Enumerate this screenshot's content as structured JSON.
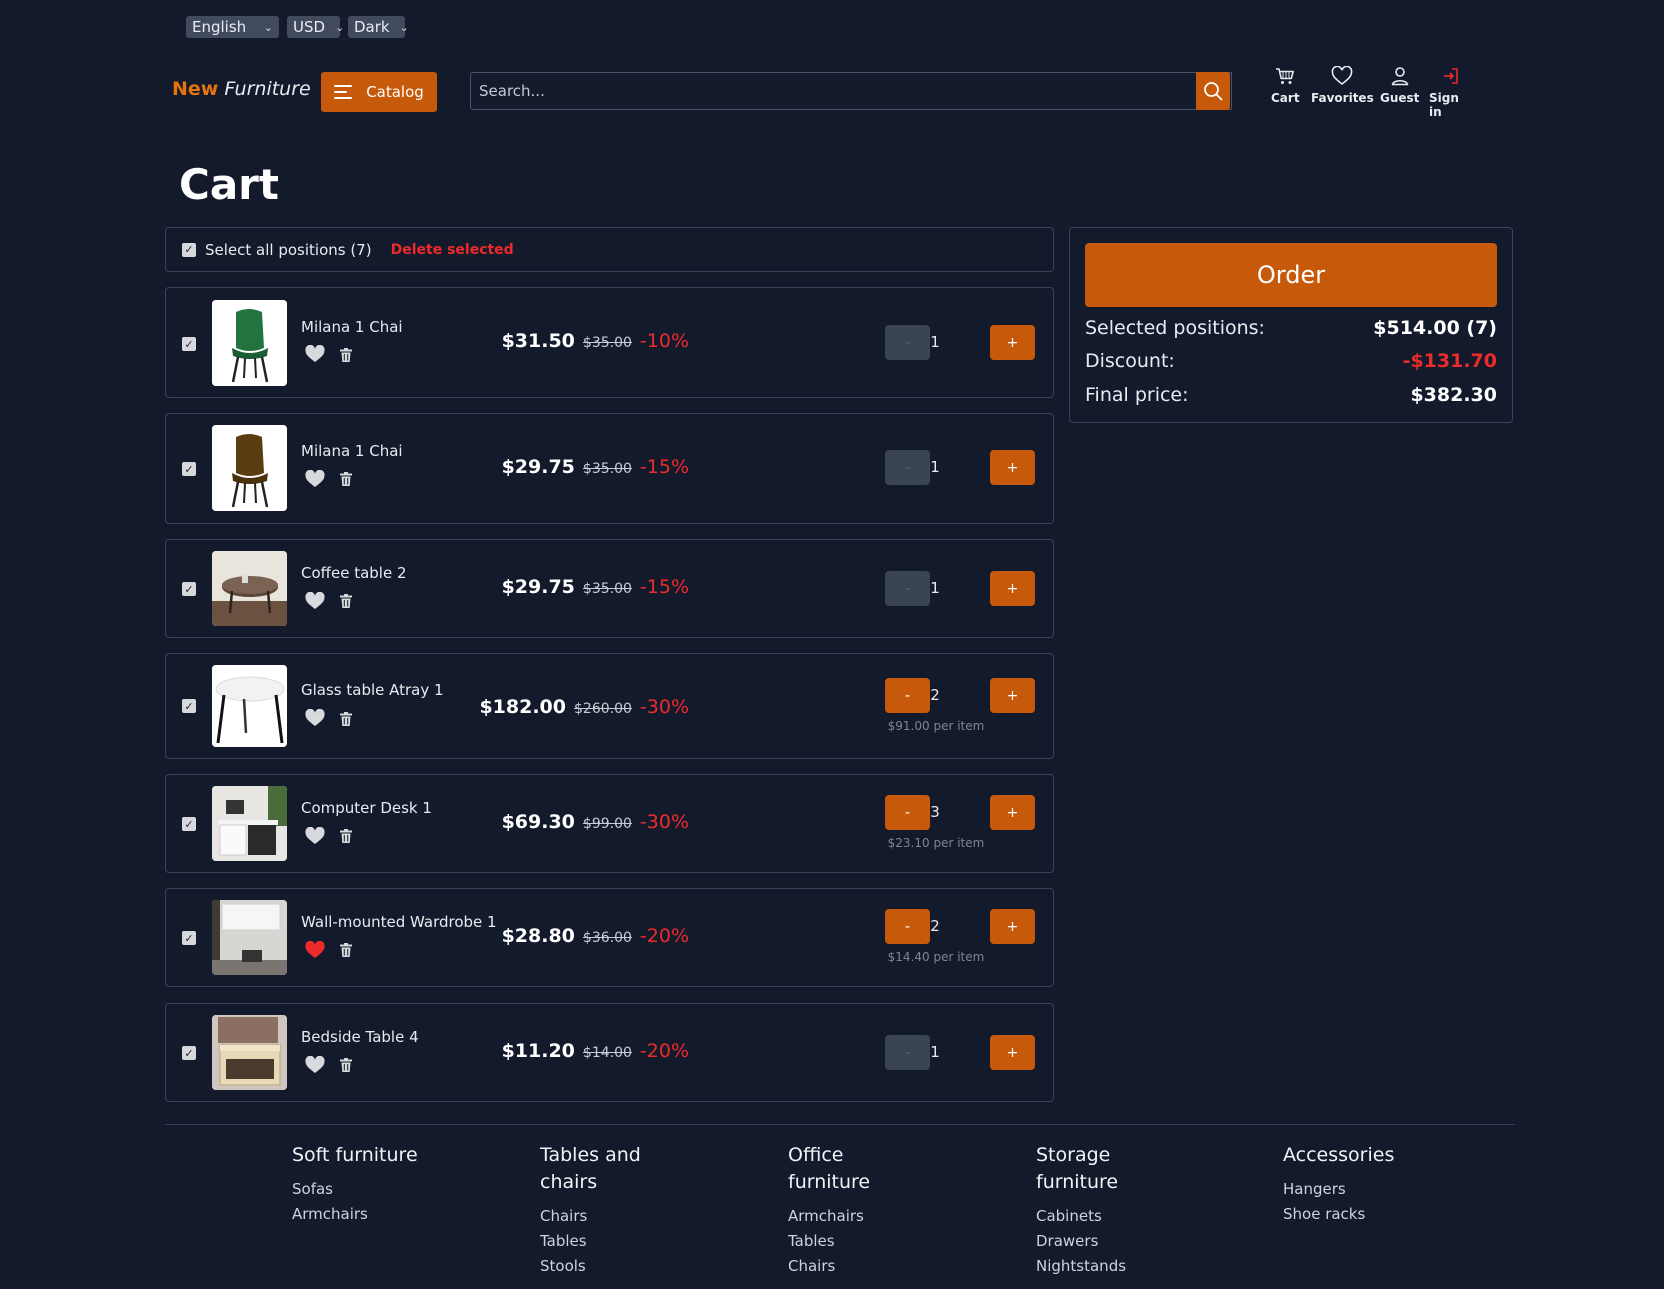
{
  "topbar": {
    "language": "English",
    "currency": "USD",
    "theme": "Dark"
  },
  "header": {
    "logo_new": "New",
    "logo_furniture": "Furniture",
    "catalog_label": "Catalog",
    "search_placeholder": "Search...",
    "nav": {
      "cart": "Cart",
      "favorites": "Favorites",
      "guest": "Guest",
      "signin": "Sign in"
    }
  },
  "page_title": "Cart",
  "select_all_label": "Select all positions (7)",
  "delete_selected_label": "Delete selected",
  "items": [
    {
      "name": "Milana 1 Chai",
      "price": "$31.50",
      "old_price": "$35.00",
      "discount": "-10%",
      "qty": "1",
      "per_item": "",
      "favorite": false,
      "minus_enabled": false
    },
    {
      "name": "Milana 1 Chai",
      "price": "$29.75",
      "old_price": "$35.00",
      "discount": "-15%",
      "qty": "1",
      "per_item": "",
      "favorite": false,
      "minus_enabled": false
    },
    {
      "name": "Coffee table 2",
      "price": "$29.75",
      "old_price": "$35.00",
      "discount": "-15%",
      "qty": "1",
      "per_item": "",
      "favorite": false,
      "minus_enabled": false
    },
    {
      "name": "Glass table Atray 1",
      "price": "$182.00",
      "old_price": "$260.00",
      "discount": "-30%",
      "qty": "2",
      "per_item": "$91.00 per item",
      "favorite": false,
      "minus_enabled": true
    },
    {
      "name": "Computer Desk 1",
      "price": "$69.30",
      "old_price": "$99.00",
      "discount": "-30%",
      "qty": "3",
      "per_item": "$23.10 per item",
      "favorite": false,
      "minus_enabled": true
    },
    {
      "name": "Wall-mounted Wardrobe 1",
      "price": "$28.80",
      "old_price": "$36.00",
      "discount": "-20%",
      "qty": "2",
      "per_item": "$14.40 per item",
      "favorite": true,
      "minus_enabled": true
    },
    {
      "name": "Bedside Table 4",
      "price": "$11.20",
      "old_price": "$14.00",
      "discount": "-20%",
      "qty": "1",
      "per_item": "",
      "favorite": false,
      "minus_enabled": false
    }
  ],
  "qty_minus": "-",
  "qty_plus": "+",
  "summary": {
    "order_label": "Order",
    "selected_label": "Selected positions:",
    "selected_value": "$514.00 (7)",
    "discount_label": "Discount:",
    "discount_value": "-$131.70",
    "final_label": "Final price:",
    "final_value": "$382.30"
  },
  "footer": [
    {
      "title": "Soft furniture",
      "links": [
        "Sofas",
        "Armchairs"
      ]
    },
    {
      "title": "Tables and chairs",
      "links": [
        "Chairs",
        "Tables",
        "Stools"
      ]
    },
    {
      "title": "Office furniture",
      "links": [
        "Armchairs",
        "Tables",
        "Chairs"
      ]
    },
    {
      "title": "Storage furniture",
      "links": [
        "Cabinets",
        "Drawers",
        "Nightstands"
      ]
    },
    {
      "title": "Accessories",
      "links": [
        "Hangers",
        "Shoe racks"
      ]
    }
  ],
  "colors": {
    "background": "#121a2b",
    "accent": "#c65a0a",
    "discount_red": "#ee2b2b"
  },
  "icons": {
    "cart": "cart-icon",
    "favorites": "heart-icon",
    "guest": "user-icon",
    "signin": "sign-in-icon",
    "search": "search-icon",
    "catalog": "menu-icon",
    "trash": "trash-icon"
  }
}
